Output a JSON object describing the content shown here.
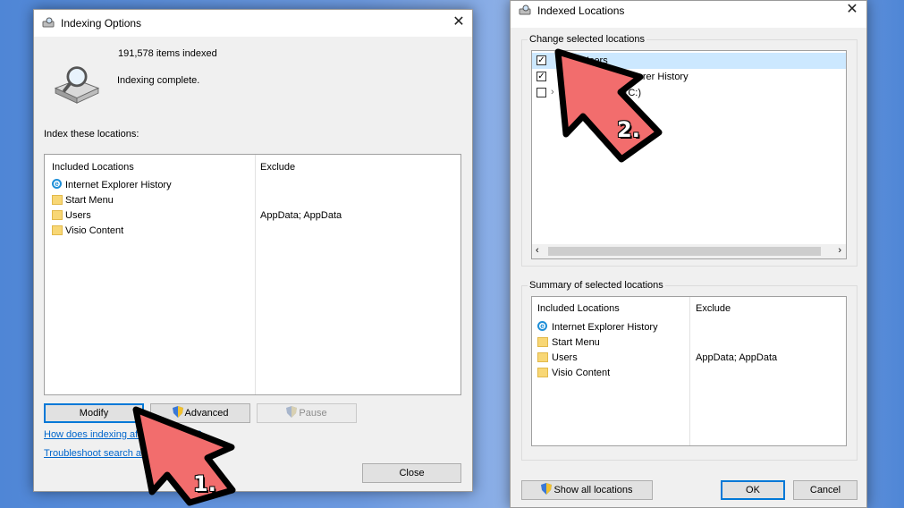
{
  "indexing_options": {
    "title": "Indexing Options",
    "items_indexed": "191,578 items indexed",
    "status": "Indexing complete.",
    "section_label": "Index these locations:",
    "columns": {
      "included": "Included Locations",
      "exclude": "Exclude"
    },
    "rows": [
      {
        "name": "Internet Explorer History",
        "icon": "ie-icon",
        "exclude": ""
      },
      {
        "name": "Start Menu",
        "icon": "folder-icon",
        "exclude": ""
      },
      {
        "name": "Users",
        "icon": "folder-icon",
        "exclude": "AppData; AppData"
      },
      {
        "name": "Visio Content",
        "icon": "folder-icon",
        "exclude": ""
      }
    ],
    "buttons": {
      "modify": "Modify",
      "advanced": "Advanced",
      "pause": "Pause",
      "close": "Close"
    },
    "links": {
      "how": "How does indexing affect searches?",
      "troubleshoot": "Troubleshoot search and indexing"
    }
  },
  "indexed_locations": {
    "title": "Indexed Locations",
    "change_label": "Change selected locations",
    "tree": [
      {
        "label": "Users",
        "checked": true,
        "expander": false
      },
      {
        "label": "Internet Explorer History",
        "checked": true,
        "expander": false
      },
      {
        "label": "Windows (C:)",
        "checked": false,
        "expander": true
      }
    ],
    "summary_label": "Summary of selected locations",
    "columns": {
      "included": "Included Locations",
      "exclude": "Exclude"
    },
    "rows": [
      {
        "name": "Internet Explorer History",
        "icon": "ie-icon",
        "exclude": ""
      },
      {
        "name": "Start Menu",
        "icon": "folder-icon",
        "exclude": ""
      },
      {
        "name": "Users",
        "icon": "folder-icon",
        "exclude": "AppData; AppData"
      },
      {
        "name": "Visio Content",
        "icon": "folder-icon",
        "exclude": ""
      }
    ],
    "buttons": {
      "show_all": "Show all locations",
      "ok": "OK",
      "cancel": "Cancel"
    }
  },
  "annotations": {
    "step1": "1.",
    "step2": "2."
  },
  "colors": {
    "arrow_fill": "#f26d6d",
    "arrow_stroke": "#000000",
    "link": "#0066cc",
    "accent": "#0078d7"
  }
}
